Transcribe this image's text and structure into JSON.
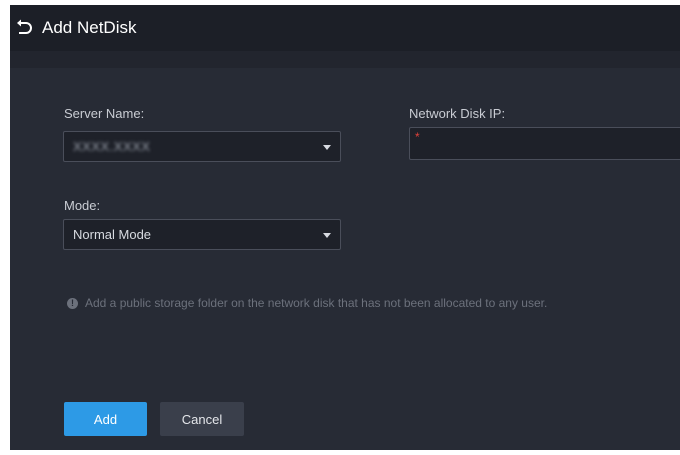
{
  "header": {
    "title": "Add NetDisk"
  },
  "form": {
    "server_name": {
      "label": "Server Name:",
      "value": "XXXX.XXXX"
    },
    "network_disk_ip": {
      "label": "Network Disk IP:",
      "required_mark": "*",
      "value": ""
    },
    "mode": {
      "label": "Mode:",
      "value": "Normal Mode"
    }
  },
  "hint": {
    "text": "Add a public storage folder on the network disk that has not been allocated to any user."
  },
  "buttons": {
    "add": "Add",
    "cancel": "Cancel"
  },
  "colors": {
    "accent": "#2d9ae6",
    "background": "#272b35",
    "header": "#1c1f27",
    "required": "#e0413a"
  }
}
